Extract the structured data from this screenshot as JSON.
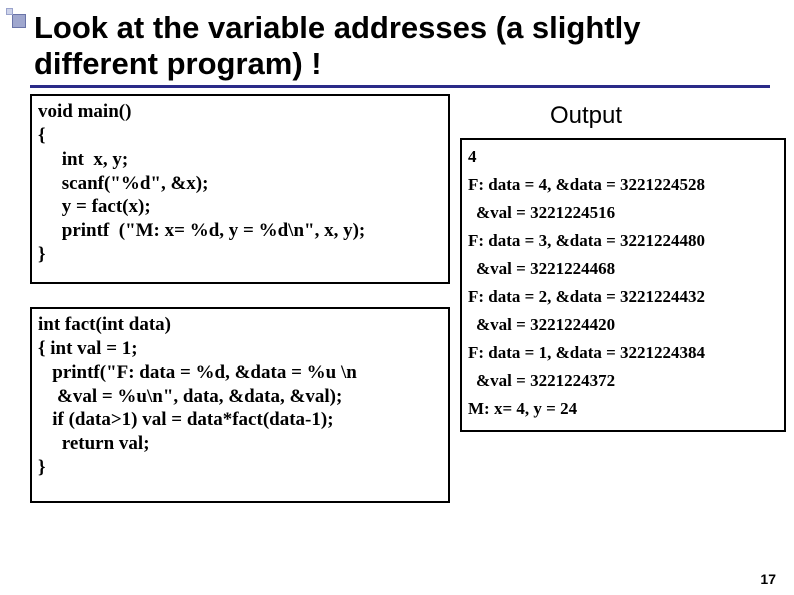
{
  "title": "Look at the variable addresses (a slightly different program) !",
  "code_main": {
    "l1": "void main()",
    "l2": "{",
    "l3": "     int  x, y;",
    "l4": "     scanf(\"%d\", &x);",
    "l5": "     y = fact(x);",
    "l6": "     printf  (\"M: x= %d, y = %d\\n\", x, y);",
    "l7": "}"
  },
  "code_fact": {
    "l1": "int fact(int data)",
    "l2": "{ int val = 1;",
    "l3": "   printf(\"F: data = %d, &data = %u \\n",
    "l4": "    &val = %u\\n\", data, &data, &val);",
    "l5": "   if (data>1) val = data*fact(data-1);",
    "l6": "     return val;",
    "l7": "}"
  },
  "output_label": "Output",
  "output": {
    "l1": "4",
    "l2": "F: data = 4, &data = 3221224528",
    "l3": " &val = 3221224516",
    "l4": "F: data = 3, &data = 3221224480",
    "l5": " &val = 3221224468",
    "l6": "F: data = 2, &data = 3221224432",
    "l7": " &val = 3221224420",
    "l8": "F: data = 1, &data = 3221224384",
    "l9": " &val = 3221224372",
    "l10": "M: x= 4, y = 24"
  },
  "page_number": "17"
}
